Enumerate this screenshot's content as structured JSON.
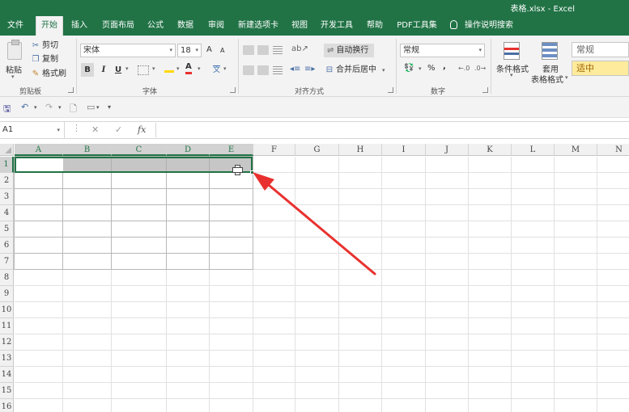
{
  "window": {
    "title": "表格.xlsx  -  Excel"
  },
  "tabs": [
    "文件",
    "开始",
    "插入",
    "页面布局",
    "公式",
    "数据",
    "审阅",
    "新建选项卡",
    "视图",
    "开发工具",
    "帮助",
    "PDF工具集"
  ],
  "active_tab": "开始",
  "tell_me": "操作说明搜索",
  "ribbon": {
    "clipboard": {
      "paste": "粘贴",
      "cut": "剪切",
      "copy": "复制",
      "format_painter": "格式刷",
      "group_label": "剪贴板"
    },
    "font": {
      "font_name": "宋体",
      "font_size": "18",
      "grow": "A",
      "shrink": "A",
      "bold": "B",
      "italic": "I",
      "underline": "U",
      "font_color_letter": "A",
      "phonetic": "文",
      "group_label": "字体"
    },
    "alignment": {
      "wrap_text": "自动换行",
      "merge_center": "合并后居中",
      "group_label": "对齐方式"
    },
    "number": {
      "format": "常规",
      "percent": "%",
      "comma": ",",
      "group_label": "数字"
    },
    "styles": {
      "conditional_formatting": "条件格式",
      "format_as_table_1": "套用",
      "format_as_table_2": "表格格式",
      "style_normal": "常规",
      "style_neutral": "适中"
    }
  },
  "formula_bar": {
    "name_box": "A1",
    "cancel_glyph": "✕",
    "enter_glyph": "✓",
    "fx": "fx",
    "value": ""
  },
  "sheet": {
    "columns": [
      "A",
      "B",
      "C",
      "D",
      "E",
      "F",
      "G",
      "H",
      "I",
      "J",
      "K",
      "L",
      "M",
      "N"
    ],
    "rows": [
      "1",
      "2",
      "3",
      "4",
      "5",
      "6",
      "7",
      "8",
      "9",
      "10",
      "11",
      "12",
      "13",
      "14",
      "15",
      "16"
    ],
    "selected_columns": [
      "A",
      "B",
      "C",
      "D",
      "E"
    ],
    "selected_row": "1"
  },
  "colors": {
    "excel_green": "#217346",
    "annotation_arrow": "#e8312f",
    "selection_fill": "#c6c6c6"
  }
}
